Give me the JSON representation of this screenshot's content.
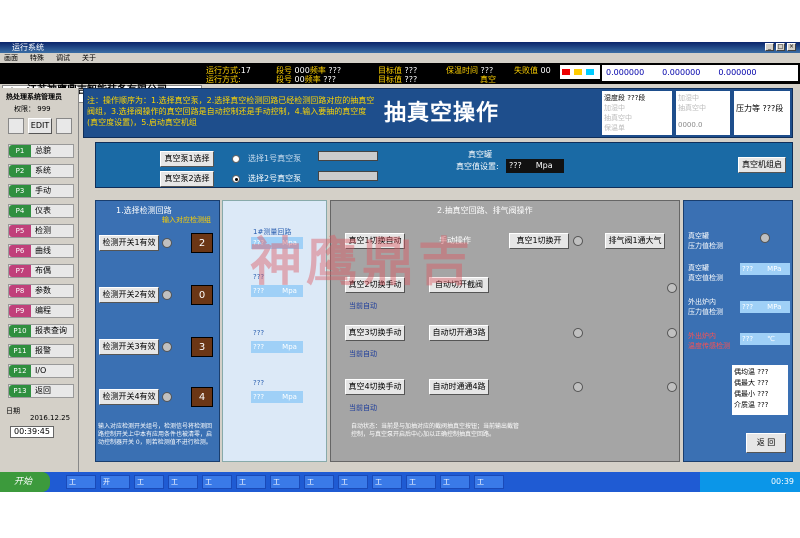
{
  "window": {
    "title": "运行系统",
    "menu": [
      "画面",
      "特殊",
      "调试",
      "关于"
    ]
  },
  "header": {
    "company": "江苏神鹰鼎吉智能装备有限公司",
    "company_en": "JIANGSU SHENYING DINGJI INTELLIGENT EQUIPMENT CO.,LTD",
    "status": [
      {
        "k": "运行方式:",
        "v": "17"
      },
      {
        "k": "运行方式:",
        "v": ""
      },
      {
        "k": "段号",
        "v": "000",
        "k2": "频率",
        "v2": "???"
      },
      {
        "k": "段号",
        "v": "00",
        "k2": "频率",
        "v2": "???"
      },
      {
        "k": "目标值",
        "v": "???"
      },
      {
        "k": "目标值",
        "v": "???"
      },
      {
        "k": "保温时间",
        "v": "???"
      },
      {
        "k": "",
        "v": "真空"
      },
      {
        "k": "失败值",
        "v": "00"
      }
    ],
    "counters": [
      "0.000000",
      "0.000000",
      "0.000000"
    ]
  },
  "sidebar": {
    "title": "热处理系统管理员",
    "sub": "权限：",
    "level": "999",
    "edit": "EDIT",
    "items": [
      {
        "key": "P1",
        "label": "总貌"
      },
      {
        "key": "P2",
        "label": "系统"
      },
      {
        "key": "P3",
        "label": "手动"
      },
      {
        "key": "P4",
        "label": "仪表"
      },
      {
        "key": "P5",
        "label": "检测"
      },
      {
        "key": "P6",
        "label": "曲线"
      },
      {
        "key": "P7",
        "label": "布偶"
      },
      {
        "key": "P8",
        "label": "参数"
      },
      {
        "key": "P9",
        "label": "编程"
      },
      {
        "key": "P10",
        "label": "报表查询"
      },
      {
        "key": "P11",
        "label": "报警"
      },
      {
        "key": "P12",
        "label": "I/O"
      },
      {
        "key": "P13",
        "label": "返回"
      }
    ],
    "date_label": "日期",
    "date": "2016.12.25",
    "time": "00:39:45"
  },
  "main": {
    "title": "抽真空操作",
    "notice": "注：操作顺序为：1.选择真空泵，2.选择真空检测回路已经检测回路对应的抽真空阀组，3.选择阀操作的真空回路是自动控制还是手动控制，4.输入要抽的真空度(真空度设置)，5.启动真空机组",
    "status_box": {
      "a": "湿度段",
      "a_v": "???段",
      "b": "加湿中",
      "c": "加湿中",
      "d": "抽真空中",
      "e": "抽真空中",
      "f": "保温单",
      "g": "压力等",
      "g_v": "???段",
      "h": "0000.0"
    },
    "pump_select": {
      "btn1": "真空泵1选择",
      "btn2": "真空泵2选择",
      "opt1": "选择1号真空泵",
      "opt2": "选择2号真空泵",
      "vac_label": "真空罐",
      "set_label": "真空值设置:",
      "set_val": "???",
      "unit": "Mpa",
      "machine_btn": "真空机组启"
    },
    "left": {
      "title": "1.选择检测回路",
      "subtitle": "输入对应检测组",
      "rows": [
        {
          "label": "检测开关1有效",
          "val": "2"
        },
        {
          "label": "检测开关2有效",
          "val": "0"
        },
        {
          "label": "检测开关3有效",
          "val": "3"
        },
        {
          "label": "检测开关4有效",
          "val": "4"
        }
      ]
    },
    "mid": {
      "title": "1#测量回路",
      "vals": [
        "???",
        "???",
        "???",
        "???"
      ],
      "unit": "Mpa",
      "labels": [
        "???",
        "???",
        "???",
        "???"
      ]
    },
    "center": {
      "title": "2.抽真空回路、排气阀操作",
      "rows": [
        {
          "a": "真空1切换自动",
          "b": "手动操作",
          "c": "真空1切换开",
          "d": "排气阀1通大气"
        },
        {
          "a": "真空2切换手动",
          "b": "自动切开截阀",
          "status": "当前自动"
        },
        {
          "a": "真空3切换手动",
          "b": "自动切开通3路",
          "status": "当前自动"
        },
        {
          "a": "真空4切换手动",
          "b": "自动时通通4路",
          "status": "当前自动"
        }
      ],
      "note": "自动状态：当前是与加抽对应的截阀抽真空按钮；当前输出截管控制，与真空泵开启后中心加以正确控制抽真空回路。"
    },
    "right": {
      "items": [
        {
          "label": "真空罐\n压力值检测"
        },
        {
          "label": "真空罐\n真空值检测",
          "v": "???",
          "u": "MPa"
        },
        {
          "label": "外出炉内\n压力值检测",
          "v": "???",
          "u": "MPa"
        },
        {
          "label": "外出炉内\n温度传感检测",
          "v": "???",
          "u": "℃"
        }
      ],
      "boxlines": [
        "偶均温 ???",
        "偶最大 ???",
        "偶最小 ???",
        "介质温 ???"
      ],
      "back": "返 回"
    },
    "bottom_note": "输入对应检测开关组号，检测信号将检测回路控制开关上中本有应用条件也被清零，启动控制器开关 0，则若检测值不进行检测。"
  },
  "watermark": "神鹰鼎吉",
  "taskbar": {
    "start": "开始",
    "time": "00:39",
    "items": [
      "工",
      "开",
      "工",
      "工",
      "工",
      "工",
      "工",
      "工",
      "工",
      "工",
      "工",
      "工",
      "工"
    ]
  }
}
